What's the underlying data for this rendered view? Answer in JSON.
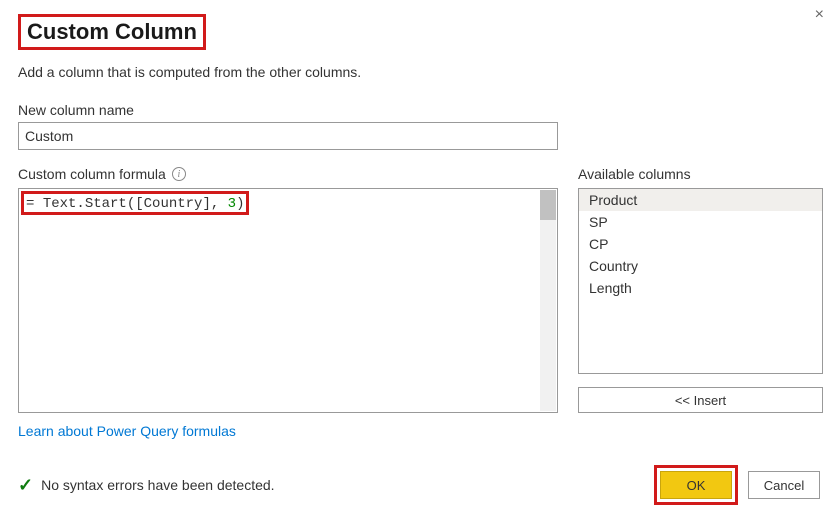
{
  "dialog": {
    "title": "Custom Column",
    "subtitle": "Add a column that is computed from the other columns.",
    "close_label": "×"
  },
  "name_field": {
    "label": "New column name",
    "value": "Custom"
  },
  "formula": {
    "label": "Custom column formula",
    "eq": "= ",
    "fn": "Text.Start",
    "open": "(",
    "col": "[Country]",
    "comma": ", ",
    "num": "3",
    "close": ")"
  },
  "learn_link": "Learn about Power Query formulas",
  "available": {
    "label": "Available columns",
    "items": [
      "Product",
      "SP",
      "CP",
      "Country",
      "Length"
    ],
    "selected_index": 0,
    "insert_label": "<< Insert"
  },
  "status": {
    "message": "No syntax errors have been detected."
  },
  "buttons": {
    "ok": "OK",
    "cancel": "Cancel"
  }
}
